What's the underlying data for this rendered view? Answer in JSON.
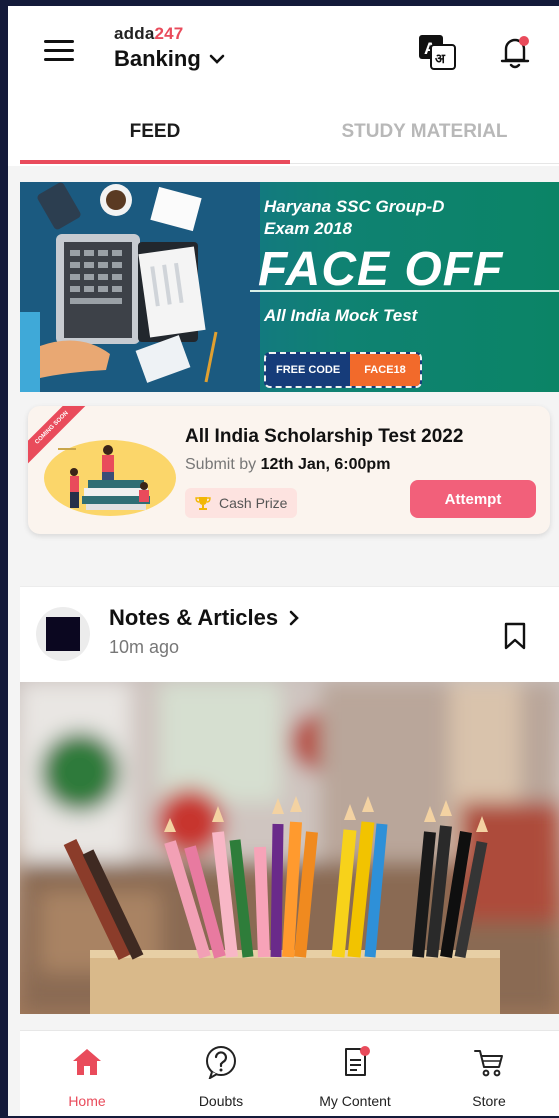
{
  "header": {
    "logo_main": "adda",
    "logo_accent": "247",
    "category": "Banking",
    "menu_icon": "hamburger-menu-icon",
    "translate_icon": "translate-icon",
    "bell_icon": "notification-bell-icon"
  },
  "tabs": [
    {
      "label": "FEED",
      "active": true
    },
    {
      "label": "STUDY MATERIAL",
      "active": false
    }
  ],
  "banner": {
    "exam_line1": "Haryana SSC Group-D",
    "exam_line2": "Exam 2018",
    "headline": "FACE OFF",
    "subline": "All India Mock Test",
    "code_label": "FREE CODE",
    "code_value": "FACE18"
  },
  "scholarship": {
    "ribbon": "COMING SOON",
    "title": "All India Scholarship Test 2022",
    "submit_prefix": "Submit by",
    "submit_date": "12th Jan, 6:00pm",
    "prize_label": "Cash Prize",
    "attempt_label": "Attempt"
  },
  "post": {
    "title": "Notes & Articles",
    "time": "10m ago"
  },
  "bottom_nav": [
    {
      "label": "Home",
      "icon": "home-icon",
      "active": true
    },
    {
      "label": "Doubts",
      "icon": "question-icon",
      "active": false
    },
    {
      "label": "My Content",
      "icon": "document-icon",
      "active": false
    },
    {
      "label": "Store",
      "icon": "cart-icon",
      "active": false
    }
  ],
  "colors": {
    "accent": "#e94b5b",
    "attempt_button": "#f2607a",
    "background": "#141a3a"
  }
}
